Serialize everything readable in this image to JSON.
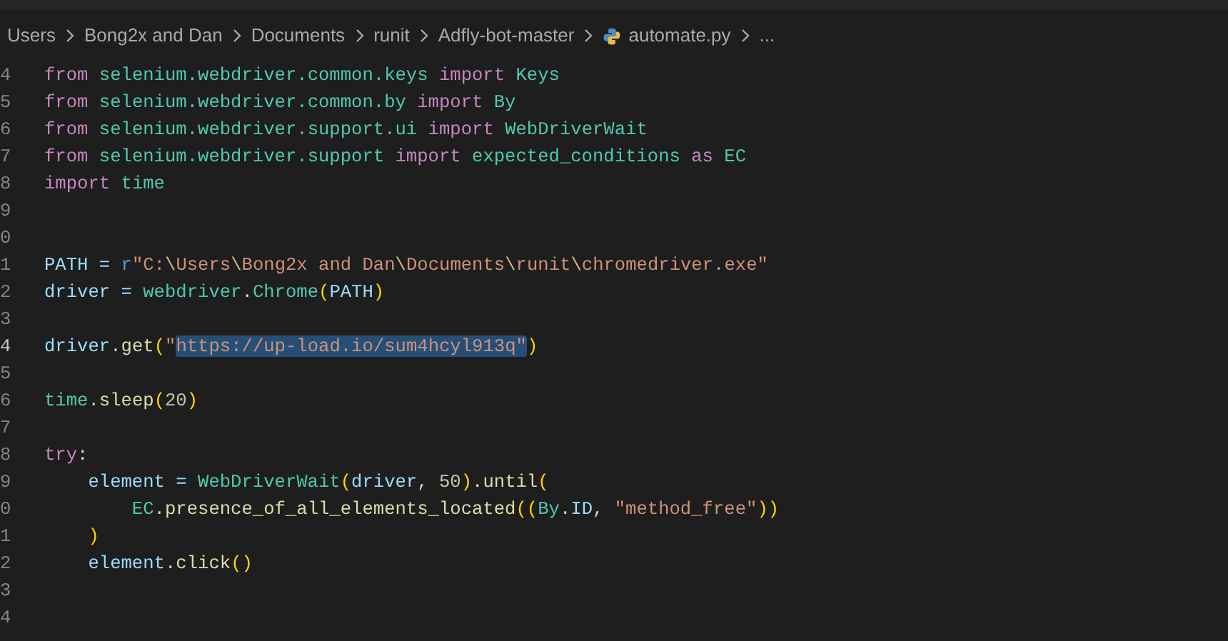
{
  "breadcrumb": [
    {
      "label": "Users",
      "kind": "folder"
    },
    {
      "label": "Bong2x and Dan",
      "kind": "folder"
    },
    {
      "label": "Documents",
      "kind": "folder"
    },
    {
      "label": "runit",
      "kind": "folder"
    },
    {
      "label": "Adfly-bot-master",
      "kind": "folder"
    },
    {
      "label": "automate.py",
      "kind": "python-file"
    },
    {
      "label": "...",
      "kind": "more"
    }
  ],
  "lines": [
    {
      "number": "4",
      "current": false,
      "tokens": [
        {
          "text": "from ",
          "kind": "keyword"
        },
        {
          "text": "selenium.webdriver.common.keys ",
          "kind": "module"
        },
        {
          "text": "import ",
          "kind": "keyword"
        },
        {
          "text": "Keys",
          "kind": "class"
        }
      ]
    },
    {
      "number": "5",
      "current": false,
      "tokens": [
        {
          "text": "from ",
          "kind": "keyword"
        },
        {
          "text": "selenium.webdriver.common.by ",
          "kind": "module"
        },
        {
          "text": "import ",
          "kind": "keyword"
        },
        {
          "text": "By",
          "kind": "class"
        }
      ]
    },
    {
      "number": "6",
      "current": false,
      "tokens": [
        {
          "text": "from ",
          "kind": "keyword"
        },
        {
          "text": "selenium.webdriver.support.ui ",
          "kind": "module"
        },
        {
          "text": "import ",
          "kind": "keyword"
        },
        {
          "text": "WebDriverWait",
          "kind": "class"
        }
      ]
    },
    {
      "number": "7",
      "current": false,
      "tokens": [
        {
          "text": "from ",
          "kind": "keyword"
        },
        {
          "text": "selenium.webdriver.support ",
          "kind": "module"
        },
        {
          "text": "import ",
          "kind": "keyword"
        },
        {
          "text": "expected_conditions ",
          "kind": "module"
        },
        {
          "text": "as ",
          "kind": "keyword"
        },
        {
          "text": "EC",
          "kind": "class"
        }
      ]
    },
    {
      "number": "8",
      "current": false,
      "tokens": [
        {
          "text": "import ",
          "kind": "keyword"
        },
        {
          "text": "time",
          "kind": "module"
        }
      ]
    },
    {
      "number": "9",
      "current": false
    },
    {
      "number": "0",
      "current": false
    },
    {
      "number": "1",
      "current": false,
      "tokens": [
        {
          "text": "PATH = ",
          "kind": "variable"
        },
        {
          "text": "r",
          "kind": "keyword-blue"
        },
        {
          "text": "\"C:",
          "kind": "string"
        },
        {
          "text": "\\",
          "kind": "escape"
        },
        {
          "text": "Users",
          "kind": "string"
        },
        {
          "text": "\\",
          "kind": "escape"
        },
        {
          "text": "Bong2x and Dan",
          "kind": "string"
        },
        {
          "text": "\\",
          "kind": "escape"
        },
        {
          "text": "Documents",
          "kind": "string"
        },
        {
          "text": "\\",
          "kind": "escape"
        },
        {
          "text": "runit",
          "kind": "string"
        },
        {
          "text": "\\",
          "kind": "escape"
        },
        {
          "text": "chromedriver.exe\"",
          "kind": "string"
        }
      ]
    },
    {
      "number": "2",
      "current": false,
      "tokens": [
        {
          "text": "driver = ",
          "kind": "variable"
        },
        {
          "text": "webdriver",
          "kind": "module"
        },
        {
          "text": ".",
          "kind": "plain"
        },
        {
          "text": "Chrome",
          "kind": "class"
        },
        {
          "text": "(",
          "kind": "bracket"
        },
        {
          "text": "PATH",
          "kind": "variable"
        },
        {
          "text": ")",
          "kind": "bracket"
        }
      ]
    },
    {
      "number": "3",
      "current": false
    },
    {
      "number": "4",
      "current": true,
      "tokens": [
        {
          "text": "driver",
          "kind": "variable"
        },
        {
          "text": ".",
          "kind": "plain"
        },
        {
          "text": "get",
          "kind": "function"
        },
        {
          "text": "(",
          "kind": "bracket"
        },
        {
          "text": "\"",
          "kind": "string"
        },
        {
          "text": "https://up-load.io/sum4hcyl913q\"",
          "kind": "selected-string"
        },
        {
          "text": ")",
          "kind": "bracket"
        }
      ]
    },
    {
      "number": "5",
      "current": false
    },
    {
      "number": "6",
      "current": false,
      "tokens": [
        {
          "text": "time",
          "kind": "module"
        },
        {
          "text": ".",
          "kind": "plain"
        },
        {
          "text": "sleep",
          "kind": "function"
        },
        {
          "text": "(",
          "kind": "bracket"
        },
        {
          "text": "20",
          "kind": "number"
        },
        {
          "text": ")",
          "kind": "bracket"
        }
      ]
    },
    {
      "number": "7",
      "current": false
    },
    {
      "number": "8",
      "current": false,
      "tokens": [
        {
          "text": "try",
          "kind": "keyword"
        },
        {
          "text": ":",
          "kind": "plain"
        }
      ]
    },
    {
      "number": "9",
      "current": false,
      "tokens": [
        {
          "text": "    element = ",
          "kind": "variable"
        },
        {
          "text": "WebDriverWait",
          "kind": "class"
        },
        {
          "text": "(",
          "kind": "bracket"
        },
        {
          "text": "driver",
          "kind": "variable"
        },
        {
          "text": ", ",
          "kind": "plain"
        },
        {
          "text": "50",
          "kind": "number"
        },
        {
          "text": ")",
          "kind": "bracket"
        },
        {
          "text": ".",
          "kind": "plain"
        },
        {
          "text": "until",
          "kind": "function"
        },
        {
          "text": "(",
          "kind": "bracket"
        }
      ]
    },
    {
      "number": "0",
      "current": false,
      "tokens": [
        {
          "text": "        EC",
          "kind": "class"
        },
        {
          "text": ".",
          "kind": "plain"
        },
        {
          "text": "presence_of_all_elements_located",
          "kind": "function"
        },
        {
          "text": "((",
          "kind": "bracket"
        },
        {
          "text": "By",
          "kind": "class"
        },
        {
          "text": ".",
          "kind": "plain"
        },
        {
          "text": "ID",
          "kind": "variable"
        },
        {
          "text": ", ",
          "kind": "plain"
        },
        {
          "text": "\"method_free\"",
          "kind": "string"
        },
        {
          "text": "))",
          "kind": "bracket"
        }
      ]
    },
    {
      "number": "1",
      "current": false,
      "tokens": [
        {
          "text": "    )",
          "kind": "bracket"
        }
      ]
    },
    {
      "number": "2",
      "current": false,
      "tokens": [
        {
          "text": "    element",
          "kind": "variable"
        },
        {
          "text": ".",
          "kind": "plain"
        },
        {
          "text": "click",
          "kind": "function"
        },
        {
          "text": "()",
          "kind": "bracket"
        }
      ]
    },
    {
      "number": "3",
      "current": false
    },
    {
      "number": "4",
      "current": false
    }
  ]
}
